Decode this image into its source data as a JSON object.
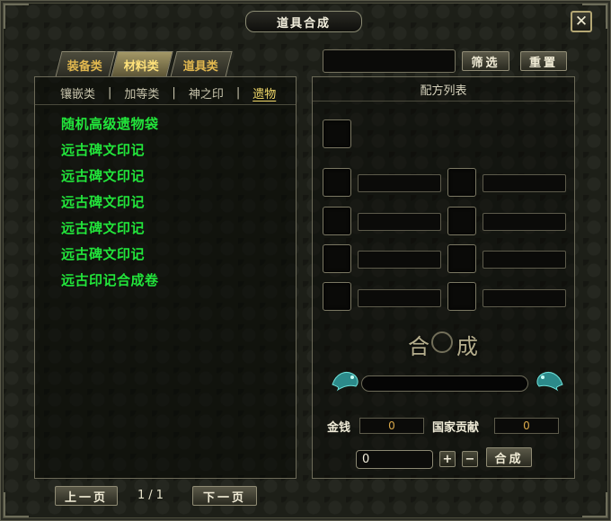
{
  "window": {
    "title": "道具合成",
    "close_icon": "close-icon"
  },
  "tabs": [
    {
      "label": "装备类",
      "active": false
    },
    {
      "label": "材料类",
      "active": true
    },
    {
      "label": "道具类",
      "active": false
    }
  ],
  "subtabs": [
    {
      "label": "镶嵌类",
      "active": false
    },
    {
      "label": "加等类",
      "active": false
    },
    {
      "label": "神之印",
      "active": false
    },
    {
      "label": "遗物",
      "active": true
    }
  ],
  "items": [
    "随机高级遗物袋",
    "远古碑文印记",
    "远古碑文印记",
    "远古碑文印记",
    "远古碑文印记",
    "远古碑文印记",
    "远古印记合成卷"
  ],
  "pager": {
    "prev_label": "上一页",
    "next_label": "下一页",
    "page_indicator": "1/1"
  },
  "filter": {
    "value": "",
    "filter_label": "筛选",
    "reset_label": "重置"
  },
  "recipe": {
    "header": "配方列表",
    "synth_emblem_left": "合",
    "synth_emblem_right": "成",
    "money_label": "金钱",
    "money_value": "0",
    "contribution_label": "国家贡献",
    "contribution_value": "0",
    "quantity_value": "0",
    "plus_label": "+",
    "minus_label": "−",
    "synth_label": "合成"
  },
  "colors": {
    "item_text": "#22e53b",
    "tab_text": "#e2b84f",
    "value_text": "#d9a84a"
  }
}
